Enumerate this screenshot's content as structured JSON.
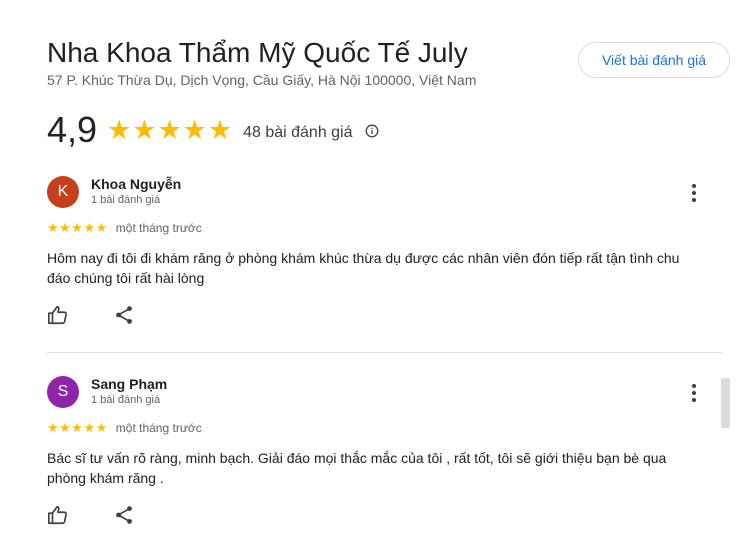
{
  "place": {
    "title": "Nha Khoa Thẩm Mỹ Quốc Tế July",
    "address": "57 P. Khúc Thừa Dụ, Dịch Vọng, Cầu Giấy, Hà Nội 100000, Việt Nam"
  },
  "write_review_label": "Viết bài đánh giá",
  "summary": {
    "rating": "4,9",
    "stars": "★★★★★",
    "count": "48 bài đánh giá",
    "info_icon": "info-icon"
  },
  "reviews": [
    {
      "avatar_letter": "K",
      "avatar_color": "#c5401b",
      "name": "Khoa Nguyễn",
      "review_count": "1 bài đánh giá",
      "stars": "★★★★★",
      "rating": 5,
      "time": "một tháng trước",
      "text_line1": "Hôm nay đi tôi đi khám răng ở phòng khám khúc thừa dụ được các nhân viên đón tiếp rất tận tình chu",
      "text_line2": "đáo chúng tôi rất hài lòng"
    },
    {
      "avatar_letter": "S",
      "avatar_color": "#8e24aa",
      "name": "Sang Phạm",
      "review_count": "1 bài đánh giá",
      "stars": "★★★★★",
      "rating": 5,
      "time": "một tháng trước",
      "text_line1": "Bác sĩ tư vấn rõ ràng, minh bạch. Giải đáo mọi thắc mắc của tôi , rất tốt, tôi sẽ giới thiệu bạn bè qua",
      "text_line2": "phòng khám răng ."
    }
  ],
  "colors": {
    "star": "#fbbc04",
    "link": "#1a73e8",
    "divider": "#e0e0e0"
  }
}
